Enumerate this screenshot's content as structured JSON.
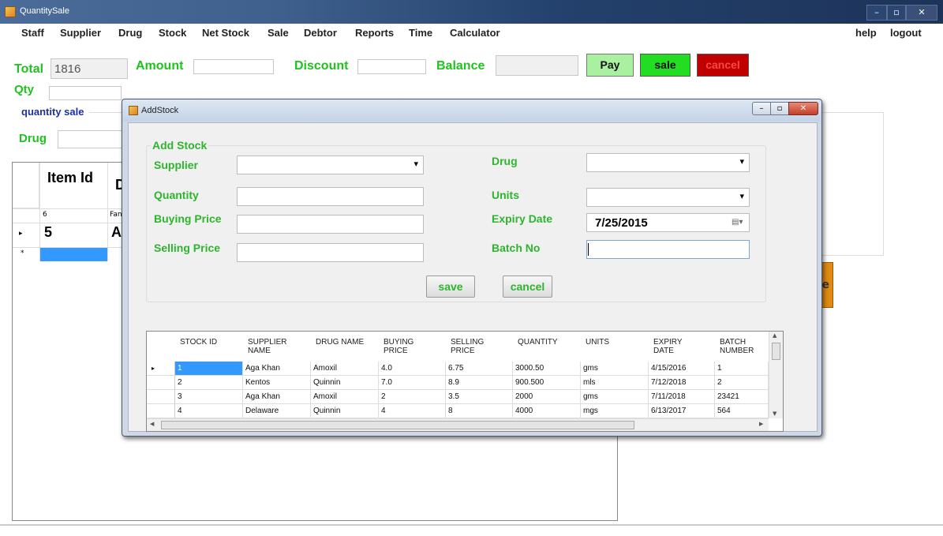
{
  "window": {
    "title": "QuantitySale"
  },
  "menu": {
    "items": [
      "Staff",
      "Supplier",
      "Drug",
      "Stock",
      "Net Stock",
      "Sale",
      "Debtor",
      "Reports",
      "Time",
      "Calculator"
    ],
    "help": "help",
    "logout": "logout"
  },
  "summary": {
    "total_label": "Total",
    "total_value": "1816",
    "amount_label": "Amount",
    "amount_value": "",
    "discount_label": "Discount",
    "discount_value": "",
    "balance_label": "Balance",
    "balance_value": "",
    "pay_label": "Pay",
    "sale_label": "sale",
    "cancel_label": "cancel",
    "qty_label": "Qty",
    "qty_value": ""
  },
  "sale_panel": {
    "group_title": "quantity sale",
    "drug_label": "Drug",
    "grid_header_itemid": "Item Id",
    "grid_header_d": "D",
    "row1_id": "6",
    "row1_d": "Fan",
    "row2_id": "5",
    "row2_d": "A",
    "orange_btn_char": "e"
  },
  "dialog": {
    "title": "AddStock",
    "group_title": "Add Stock",
    "supplier_label": "Supplier",
    "supplier_value": "",
    "quantity_label": "Quantity",
    "quantity_value": "",
    "buying_price_label": "Buying Price",
    "buying_price_value": "",
    "selling_price_label": "Selling Price",
    "selling_price_value": "",
    "drug_label": "Drug",
    "drug_value": "",
    "units_label": "Units",
    "units_value": "",
    "expiry_label": "Expiry Date",
    "expiry_value": "7/25/2015",
    "batch_label": "Batch No",
    "batch_value": "",
    "save_label": "save",
    "cancel_label": "cancel"
  },
  "stock_table": {
    "columns": [
      "STOCK ID",
      "SUPPLIER NAME",
      "DRUG NAME",
      "BUYING PRICE",
      "SELLING PRICE",
      "QUANTITY",
      "UNITS",
      "EXPIRY DATE",
      "BATCH NUMBER"
    ],
    "rows": [
      [
        "1",
        "Aga Khan",
        "Amoxil",
        "4.0",
        "6.75",
        "3000.50",
        "gms",
        "4/15/2016",
        "1"
      ],
      [
        "2",
        "Kentos",
        "Quinnin",
        "7.0",
        "8.9",
        "900.500",
        "mls",
        "7/12/2018",
        "2"
      ],
      [
        "3",
        "Aga Khan",
        "Amoxil",
        "2",
        "3.5",
        "2000",
        "gms",
        "7/11/2018",
        "23421"
      ],
      [
        "4",
        "Delaware",
        "Quinnin",
        "4",
        "8",
        "4000",
        "mgs",
        "6/13/2017",
        "564"
      ]
    ]
  }
}
